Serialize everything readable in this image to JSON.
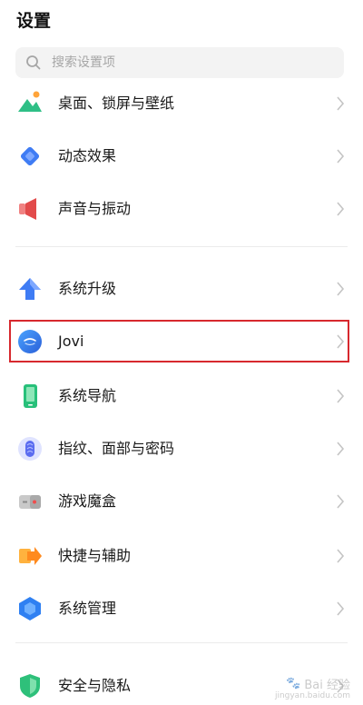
{
  "header": {
    "title": "设置"
  },
  "search": {
    "placeholder": "搜索设置项"
  },
  "items": [
    {
      "label": "桌面、锁屏与壁纸",
      "icon": "wallpaper-icon"
    },
    {
      "label": "动态效果",
      "icon": "dynamic-effect-icon"
    },
    {
      "label": "声音与振动",
      "icon": "speaker-icon"
    },
    {
      "label": "系统升级",
      "icon": "upgrade-arrow-icon"
    },
    {
      "label": "Jovi",
      "icon": "jovi-icon"
    },
    {
      "label": "系统导航",
      "icon": "navigation-phone-icon"
    },
    {
      "label": "指纹、面部与密码",
      "icon": "fingerprint-icon"
    },
    {
      "label": "游戏魔盒",
      "icon": "game-box-icon"
    },
    {
      "label": "快捷与辅助",
      "icon": "shortcut-arrow-icon"
    },
    {
      "label": "系统管理",
      "icon": "system-management-hexagon-icon"
    },
    {
      "label": "安全与隐私",
      "icon": "security-shield-icon"
    }
  ],
  "watermark": {
    "text": "Bai 经验",
    "sub": "jingyan.baidu.com"
  },
  "colors": {
    "highlight": "#d7282e",
    "accent_blue": "#3f7cf4"
  }
}
